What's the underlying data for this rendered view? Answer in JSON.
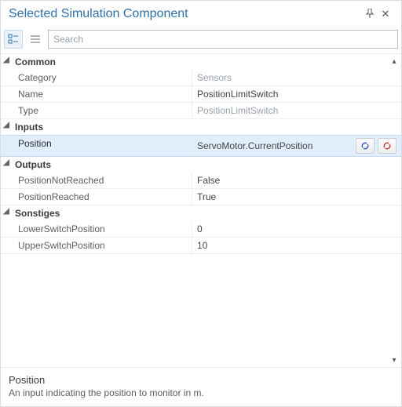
{
  "title": "Selected Simulation Component",
  "search": {
    "placeholder": "Search",
    "value": ""
  },
  "groups": [
    {
      "label": "Common",
      "rows": [
        {
          "key": "Category",
          "val": "Sensors",
          "readonly": true
        },
        {
          "key": "Name",
          "val": "PositionLimitSwitch"
        },
        {
          "key": "Type",
          "val": "PositionLimitSwitch",
          "readonly": true
        }
      ]
    },
    {
      "label": "Inputs",
      "rows": [
        {
          "key": "Position",
          "val": "ServoMotor.CurrentPosition",
          "selected": true
        }
      ]
    },
    {
      "label": "Outputs",
      "rows": [
        {
          "key": "PositionNotReached",
          "val": "False"
        },
        {
          "key": "PositionReached",
          "val": "True"
        }
      ]
    },
    {
      "label": "Sonstiges",
      "rows": [
        {
          "key": "LowerSwitchPosition",
          "val": "0"
        },
        {
          "key": "UpperSwitchPosition",
          "val": "10"
        }
      ]
    }
  ],
  "description": {
    "name": "Position",
    "text": "An input indicating the position to monitor in m."
  }
}
